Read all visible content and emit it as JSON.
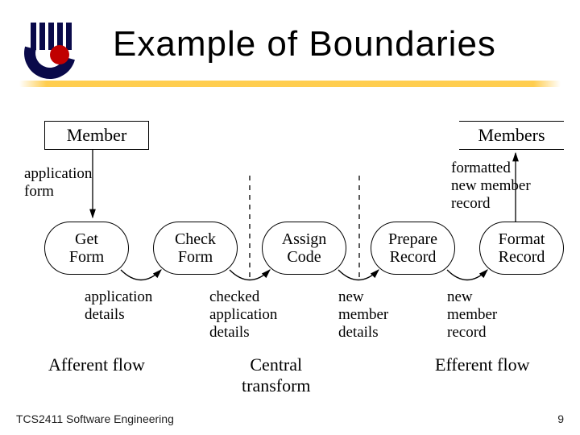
{
  "title": "Example of Boundaries",
  "entities": {
    "member": "Member",
    "members": "Members"
  },
  "labels": {
    "application_form": "application\nform",
    "formatted_new_member_record": "formatted\nnew member\nrecord",
    "application_details": "application\ndetails",
    "checked_application_details": "checked\napplication\ndetails",
    "new_member_details": "new\nmember\ndetails",
    "new_member_record": "new\nmember\nrecord"
  },
  "processes": {
    "get_form": "Get\nForm",
    "check_form": "Check\nForm",
    "assign_code": "Assign\nCode",
    "prepare_record": "Prepare\nRecord",
    "format_record": "Format\nRecord"
  },
  "flows": {
    "afferent": "Afferent flow",
    "central": "Central\ntransform",
    "efferent": "Efferent flow"
  },
  "footer": {
    "course": "TCS2411 Software Engineering",
    "page": "9"
  }
}
